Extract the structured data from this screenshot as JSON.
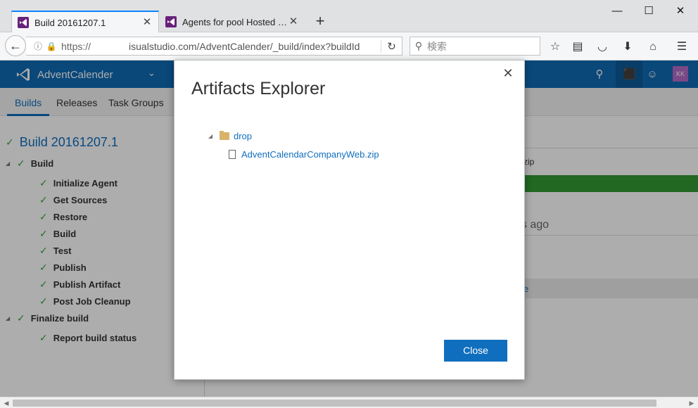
{
  "browser": {
    "tabs": [
      {
        "label": "Build 20161207.1",
        "active": true
      },
      {
        "label": "Agents for pool Hosted - ..."
      }
    ],
    "new_tab": "+",
    "window": {
      "minimize": "—",
      "maximize": "☐",
      "close": "✕"
    },
    "url_prefix": "https://",
    "url_rest": "isualstudio.com/AdventCalender/_build/index?buildId",
    "search_placeholder": "検索"
  },
  "app": {
    "project": "AdventCalender",
    "avatar_initials": "KK",
    "tabs": [
      "Builds",
      "Releases",
      "Task Groups"
    ],
    "build_title": "Build 20161207.1",
    "tree": [
      {
        "label": "Build",
        "level": 0,
        "expandable": true
      },
      {
        "label": "Initialize Agent",
        "level": 1
      },
      {
        "label": "Get Sources",
        "level": 1
      },
      {
        "label": "Restore",
        "level": 1
      },
      {
        "label": "Build",
        "level": 1
      },
      {
        "label": "Test",
        "level": 1
      },
      {
        "label": "Publish",
        "level": 1
      },
      {
        "label": "Publish Artifact",
        "level": 1
      },
      {
        "label": "Post Job Cleanup",
        "level": 1
      },
      {
        "label": "Finalize build",
        "level": 0,
        "expandable": true
      },
      {
        "label": "Report build status",
        "level": 1
      }
    ],
    "right_fragments": {
      "zip": "zip",
      "ago": "ds ago",
      "link": "e"
    }
  },
  "dialog": {
    "title": "Artifacts Explorer",
    "folder": "drop",
    "file": "AdventCalendarCompanyWeb.zip",
    "close_button": "Close",
    "close_icon": "✕"
  },
  "colors": {
    "accent": "#106ebe",
    "app_header": "#0f6ab4",
    "success_green": "#3aa43a",
    "vs_purple": "#68217a"
  }
}
